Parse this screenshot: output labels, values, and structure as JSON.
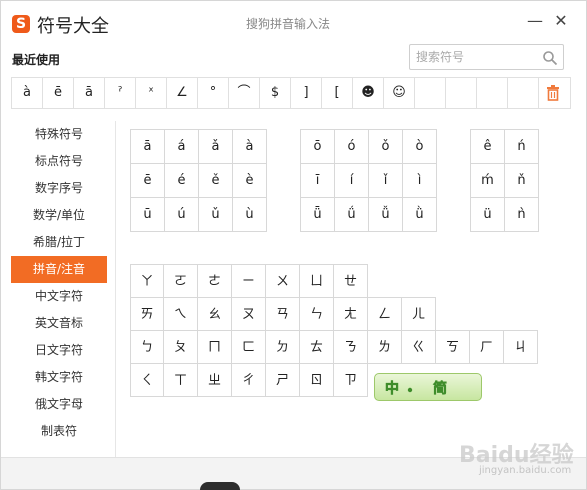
{
  "titlebar": {
    "logo_text": "S",
    "app_title": "符号大全",
    "ime_name": "搜狗拼音输入法",
    "min_icon": "minimize-icon",
    "close_icon": "close-icon",
    "min_glyph": "—",
    "close_glyph": "✕"
  },
  "recent": {
    "label": "最近使用",
    "items": [
      "à",
      "ē",
      "ā",
      "ˀ",
      "ˣ",
      "∠",
      "°",
      "⌒",
      "$",
      "]",
      "[",
      "☻",
      "☺",
      "",
      "",
      "",
      "",
      ""
    ]
  },
  "search": {
    "placeholder": "搜索符号",
    "value": ""
  },
  "sidebar": {
    "items": [
      {
        "label": "特殊符号"
      },
      {
        "label": "标点符号"
      },
      {
        "label": "数字序号"
      },
      {
        "label": "数学/单位"
      },
      {
        "label": "希腊/拉丁"
      },
      {
        "label": "拼音/注音",
        "active": true
      },
      {
        "label": "中文字符"
      },
      {
        "label": "英文音标"
      },
      {
        "label": "日文字符"
      },
      {
        "label": "韩文字符"
      },
      {
        "label": "俄文字母"
      },
      {
        "label": "制表符"
      }
    ]
  },
  "pinyin": {
    "group_a": [
      [
        "ā",
        "á",
        "ǎ",
        "à"
      ],
      [
        "ē",
        "é",
        "ě",
        "è"
      ],
      [
        "ū",
        "ú",
        "ǔ",
        "ù"
      ]
    ],
    "group_o": [
      [
        "ō",
        "ó",
        "ǒ",
        "ò"
      ],
      [
        "ī",
        "í",
        "ǐ",
        "ì"
      ],
      [
        "ǖ",
        "ǘ",
        "ǚ",
        "ǜ"
      ]
    ],
    "group_e": [
      [
        "ê",
        "ń"
      ],
      [
        "ḿ",
        "ň"
      ],
      [
        "ü",
        "ǹ"
      ]
    ]
  },
  "bopomofo": {
    "rows": [
      [
        "ㄚ",
        "ㄛ",
        "ㄜ",
        "ㄧ",
        "ㄨ",
        "ㄩ",
        "ㄝ"
      ],
      [
        "ㄞ",
        "ㄟ",
        "ㄠ",
        "ㄡ",
        "ㄢ",
        "ㄣ",
        "ㄤ",
        "ㄥ",
        "ㄦ"
      ],
      [
        "ㄅ",
        "ㄆ",
        "ㄇ",
        "ㄈ",
        "ㄉ",
        "ㄊ",
        "ㄋ",
        "ㄌ",
        "ㄍ",
        "ㄎ",
        "ㄏ",
        "ㄐ"
      ],
      [
        "ㄑ",
        "ㄒ",
        "ㄓ",
        "ㄔ",
        "ㄕ",
        "ㄖ",
        "ㄗ"
      ]
    ]
  },
  "mode_badge": {
    "left": "中",
    "right": "简"
  },
  "watermark": {
    "main": "Baidu经验",
    "sub": "jingyan.baidu.com"
  },
  "colors": {
    "accent": "#f26c24",
    "logo": "#ef5a1a",
    "badge_green": "#3f8d2b"
  }
}
